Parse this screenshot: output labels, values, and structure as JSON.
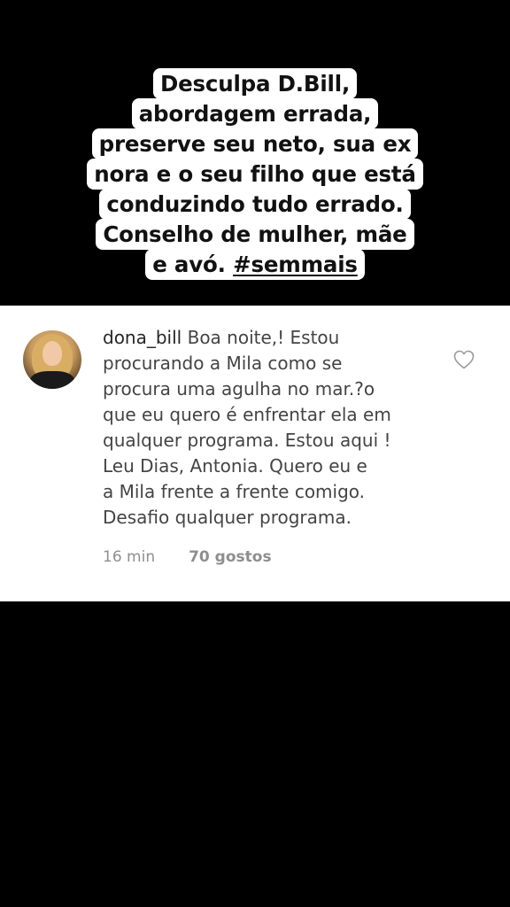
{
  "caption": {
    "lines": [
      "Desculpa D.Bill,",
      "abordagem errada,",
      "preserve seu neto, sua ex",
      "nora e o seu filho que está",
      "conduzindo tudo errado.",
      "Conselho de mulher, mãe"
    ],
    "last_line_prefix": "e avó. ",
    "hashtag": "#semmais"
  },
  "comment": {
    "username": "dona_bill",
    "text": "Boa noite,! Estou\nprocurando a Mila como se\nprocura uma agulha no mar.?o\nque eu quero é enfrentar ela  em\nqualquer programa.  Estou aqui !\nLeu Dias, Antonia. Quero eu e\na Mila frente a frente comigo.\nDesafio qualquer programa.",
    "time": "16 min",
    "likes": "70 gostos",
    "heart_icon": "heart-outline-icon",
    "avatar_icon": "profile-photo"
  },
  "colors": {
    "background": "#000000",
    "caption_bg": "#ffffff",
    "card_bg": "#ffffff",
    "meta_text": "#8e8e8e"
  }
}
